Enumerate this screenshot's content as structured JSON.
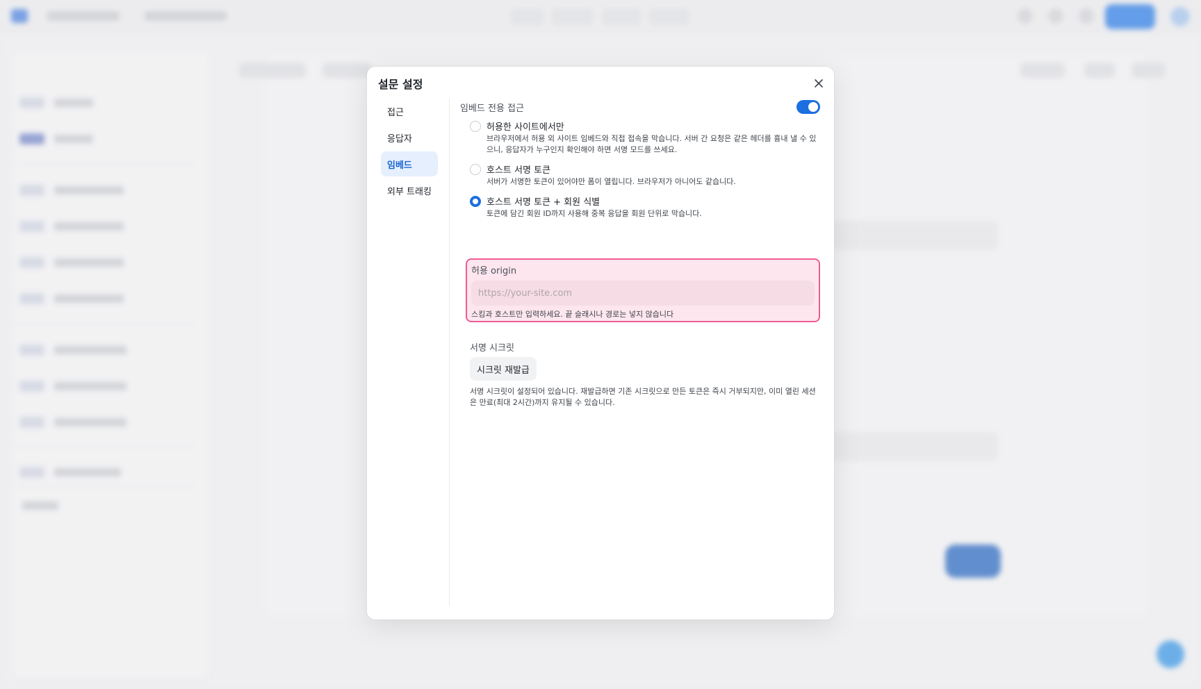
{
  "modal": {
    "title": "설문 설정",
    "nav": [
      {
        "label": "접근",
        "active": false
      },
      {
        "label": "응답자",
        "active": false
      },
      {
        "label": "임베드",
        "active": true
      },
      {
        "label": "외부 트래킹",
        "active": false
      }
    ],
    "embed": {
      "section_title": "임베드 전용 접근",
      "toggle_on": true,
      "options": [
        {
          "label": "허용한 사이트에서만",
          "description": "브라우저에서 허용 외 사이트 임베드와 직접 접속을 막습니다. 서버 간 요청은 같은 헤더를 흉내 낼 수 있으니, 응답자가 누구인지 확인해야 하면 서명 모드를 쓰세요.",
          "selected": false
        },
        {
          "label": "호스트 서명 토큰",
          "description": "서버가 서명한 토큰이 있어야만 폼이 열립니다. 브라우저가 아니어도 같습니다.",
          "selected": false
        },
        {
          "label": "호스트 서명 토큰 + 회원 식별",
          "description": "토큰에 담긴 회원 ID까지 사용해 중복 응답을 회원 단위로 막습니다.",
          "selected": true
        }
      ],
      "origin": {
        "label": "허용 origin",
        "value": "",
        "placeholder": "https://your-site.com",
        "hint": "스킴과 호스트만 입력하세요. 끝 슬래시나 경로는 넣지 않습니다"
      },
      "secret": {
        "label": "서명 시크릿",
        "button_label": "시크릿 재발급",
        "description": "서명 시크릿이 설정되어 있습니다. 재발급하면 기존 시크릿으로 만든 토큰은 즉시 거부되지만, 이미 열린 세션은 만료(최대 2시간)까지 유지될 수 있습니다."
      }
    }
  },
  "colors": {
    "accent": "#1b6fe0",
    "highlight_border": "#ee5c93",
    "highlight_fill": "#fde6ee"
  },
  "icons": {
    "close": "close-icon"
  }
}
